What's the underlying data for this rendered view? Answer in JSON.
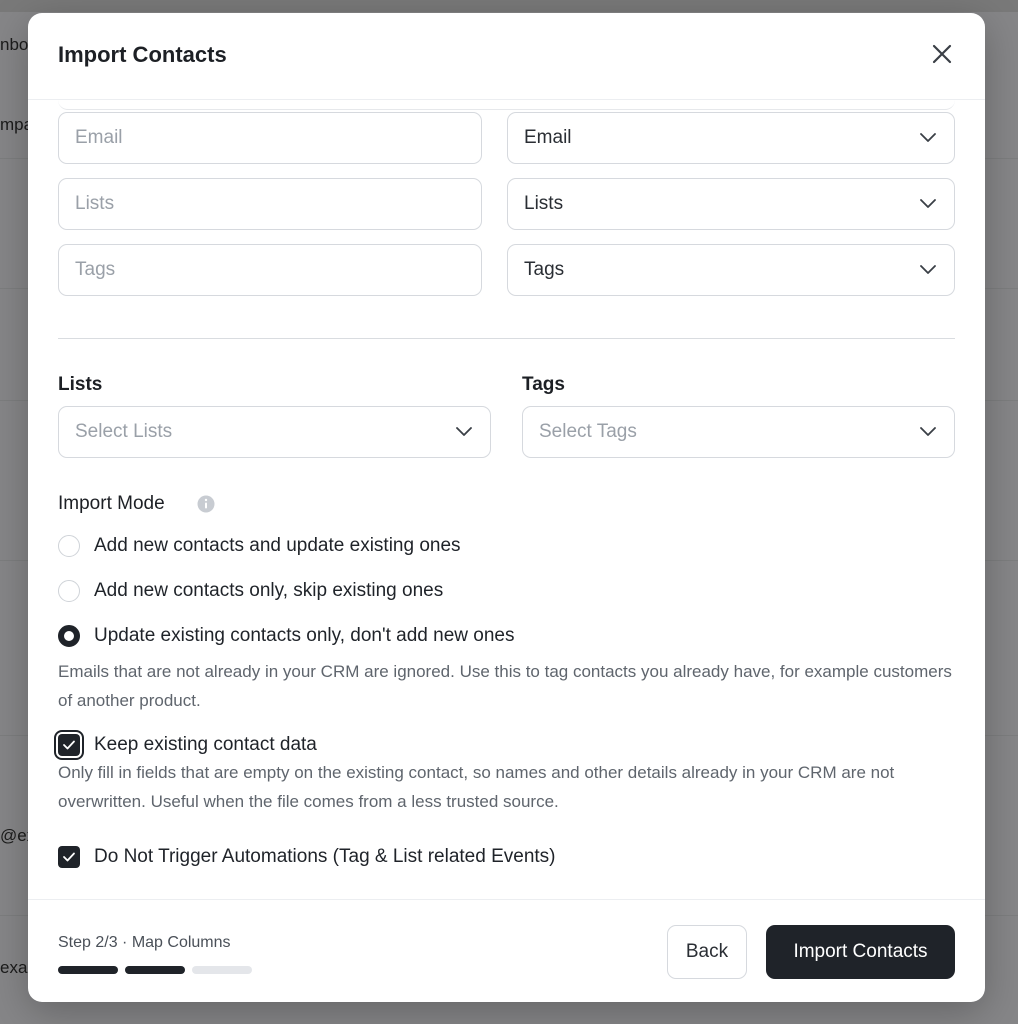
{
  "background": {
    "fragments": [
      "nbo",
      "mpa",
      "@ex",
      "exa"
    ]
  },
  "modal": {
    "title": "Import Contacts",
    "mapping_rows": [
      {
        "source_placeholder": "Email",
        "target_value": "Email"
      },
      {
        "source_placeholder": "Lists",
        "target_value": "Lists"
      },
      {
        "source_placeholder": "Tags",
        "target_value": "Tags"
      }
    ],
    "lists": {
      "label": "Lists",
      "placeholder": "Select Lists"
    },
    "tags": {
      "label": "Tags",
      "placeholder": "Select Tags"
    },
    "import_mode": {
      "label": "Import Mode",
      "options": [
        {
          "label": "Add new contacts and update existing ones",
          "selected": false
        },
        {
          "label": "Add new contacts only, skip existing ones",
          "selected": false
        },
        {
          "label": "Update existing contacts only, don't add new ones",
          "selected": true
        }
      ],
      "help": "Emails that are not already in your CRM are ignored. Use this to tag contacts you already have, for example customers of another product."
    },
    "keep_data": {
      "label": "Keep existing contact data",
      "checked": true,
      "help": "Only fill in fields that are empty on the existing contact, so names and other details already in your CRM are not overwritten. Useful when the file comes from a less trusted source."
    },
    "no_automations": {
      "label": "Do Not Trigger Automations (Tag & List related Events)",
      "checked": true
    },
    "footer": {
      "step_text": "Step 2/3 · Map Columns",
      "step_current": 2,
      "step_total": 3,
      "back_label": "Back",
      "import_label": "Import Contacts"
    }
  },
  "colors": {
    "primary": "#1f2329",
    "border": "#d6d9de",
    "placeholder": "#9aa0a8"
  }
}
